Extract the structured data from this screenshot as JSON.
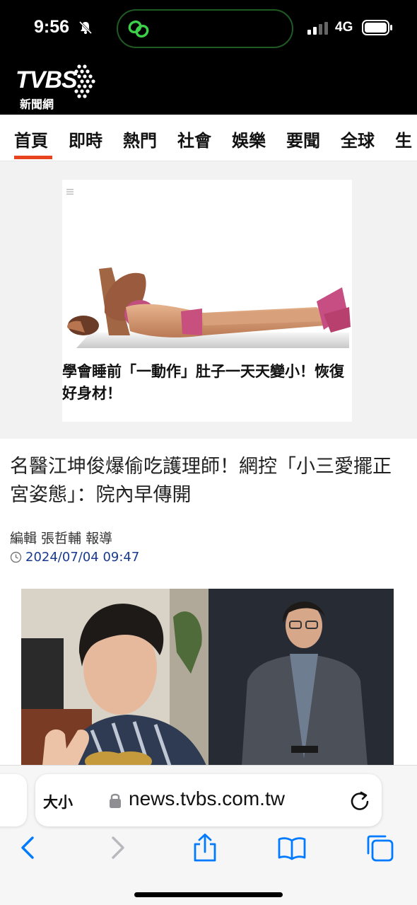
{
  "status_bar": {
    "time": "9:56",
    "network": "4G"
  },
  "site": {
    "logo_main": "TVBS",
    "logo_sub": "新聞網"
  },
  "nav": {
    "tabs": [
      "首頁",
      "即時",
      "熱門",
      "社會",
      "娛樂",
      "要聞",
      "全球",
      "生"
    ],
    "active_index": 0
  },
  "ad": {
    "title": "學會睡前「一動作」肚子一天天變小！恢復好身材！"
  },
  "article": {
    "title": "名醫江坤俊爆偷吃護理師！網控「小三愛擺正宮姿態」：院內早傳開",
    "byline": "編輯 張哲輔 報導",
    "datetime": "2024/07/04 09:47"
  },
  "browser": {
    "text_size_label": "大小",
    "url": "news.tvbs.com.tw"
  },
  "colors": {
    "accent": "#e8431f",
    "date": "#1a3a8f",
    "ios_blue": "#007aff"
  }
}
